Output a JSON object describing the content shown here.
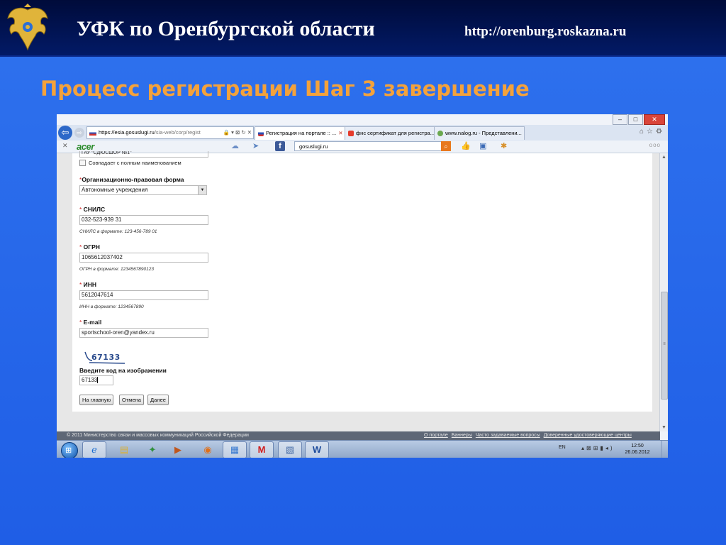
{
  "slide": {
    "org_title": "УФК по Оренбургской области",
    "org_url": "http://orenburg.roskazna.ru",
    "title": "Процесс регистрации Шаг 3 завершение",
    "colors": {
      "background": "#2565ea",
      "topbar": "#000d44",
      "title": "#f4a23b"
    }
  },
  "browser": {
    "address": {
      "scheme": "https://",
      "host": "esia.gosuslugi.ru",
      "path": "/sia-web/corp/regist"
    },
    "tabs": [
      {
        "label": "Регистрация на портале :: ...",
        "active": true
      },
      {
        "label": "фнс сертификат для регистра...",
        "active": false
      },
      {
        "label": "www.nalog.ru - Представлени...",
        "active": false
      }
    ],
    "toolbar": {
      "brand": "acer",
      "search_value": "gosuslugi.ru"
    }
  },
  "form": {
    "top_input_value": "ГАУ \"СДЮСШОР №1\"",
    "same_name_checkbox": "Совпадает с полным наименованием",
    "legal_form": {
      "label": "Организационно-правовая форма",
      "value": "Автономные учреждения"
    },
    "snils": {
      "label": "СНИЛС",
      "value": "032-523-939 31",
      "hint": "СНИЛС в формате: 123-456-789 01"
    },
    "ogrn": {
      "label": "ОГРН",
      "value": "1065612037402",
      "hint": "ОГРН в формате: 1234567890123"
    },
    "inn": {
      "label": "ИНН",
      "value": "5612047614",
      "hint": "ИНН в формате: 1234567890"
    },
    "email": {
      "label": "E-mail",
      "value": "sportschool-oren@yandex.ru"
    },
    "captcha": {
      "image_text": "67133",
      "label": "Введите код на изображении",
      "value": "67133"
    },
    "buttons": {
      "home": "На главную",
      "cancel": "Отмена",
      "next": "Далее"
    }
  },
  "footer": {
    "copyright": "© 2011 Министерство связи и массовых коммуникаций Российской Федерации",
    "links": [
      "О портале",
      "Баннеры",
      "Часто задаваемые вопросы",
      "Доверенные удостоверяющие центры"
    ]
  },
  "taskbar": {
    "language": "EN",
    "time": "12:50",
    "date": "26.06.2012",
    "apps": [
      "internet-explorer",
      "folder",
      "media",
      "player",
      "firefox",
      "remote-desktop",
      "m-app",
      "paint",
      "word"
    ]
  }
}
